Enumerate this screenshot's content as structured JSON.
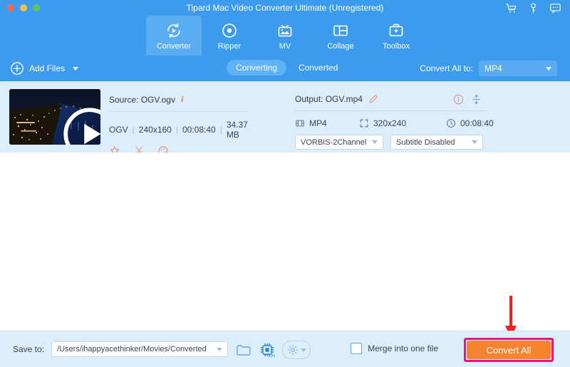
{
  "window": {
    "title": "Tipard Mac Video Converter Ultimate (Unregistered)",
    "traffic_lights": [
      "close-red",
      "minimize-yellow",
      "maximize-green"
    ],
    "right_icons": [
      {
        "name": "cart-icon",
        "label": "Cart"
      },
      {
        "name": "key-icon",
        "label": "Register"
      },
      {
        "name": "feedback-icon",
        "label": "Feedback"
      }
    ]
  },
  "tabs": [
    {
      "label": "Converter",
      "icon": "converter-icon",
      "active": true
    },
    {
      "label": "Ripper",
      "icon": "ripper-icon",
      "active": false
    },
    {
      "label": "MV",
      "icon": "mv-icon",
      "active": false
    },
    {
      "label": "Collage",
      "icon": "collage-icon",
      "active": false
    },
    {
      "label": "Toolbox",
      "icon": "toolbox-icon",
      "active": false
    }
  ],
  "actionbar": {
    "add_files_label": "Add Files",
    "segments": [
      {
        "label": "Converting",
        "active": true
      },
      {
        "label": "Converted",
        "active": false
      }
    ],
    "convert_all_to_label": "Convert All to:",
    "convert_all_to_value": "MP4"
  },
  "file_item": {
    "source_label": "Source: OGV.ogv",
    "meta": {
      "format": "OGV",
      "resolution": "240x160",
      "duration": "00:08:40",
      "size": "34.37 MB"
    },
    "tools": [
      {
        "name": "enhance-icon",
        "label": "Enhance"
      },
      {
        "name": "cut-icon",
        "label": "Cut"
      },
      {
        "name": "effect-icon",
        "label": "Effect"
      }
    ],
    "output_label": "Output: OGV.mp4",
    "output": {
      "format": "MP4",
      "resolution": "320x240",
      "duration": "00:08:40",
      "audio_track": "VORBIS-2Channel",
      "subtitle": "Subtitle Disabled"
    },
    "profile_badge": "MP4"
  },
  "bottombar": {
    "save_to_label": "Save to:",
    "save_to_path": "/Users/ihappyacethinker/Movies/Converted",
    "merge_label": "Merge into one file",
    "merge_checked": false,
    "convert_all_label": "Convert All",
    "icons": [
      {
        "name": "folder-icon",
        "label": "Open folder"
      },
      {
        "name": "gpu-acceleration-icon",
        "label": "GPU Acceleration ON"
      },
      {
        "name": "preferences-gear-icon",
        "label": "Preferences"
      }
    ]
  },
  "annotation": {
    "arrow": "red-down-arrow",
    "highlight_target": "convert-all-button"
  },
  "colors": {
    "header_blue": "#3d9bee",
    "tab_active_blue": "#5badf2",
    "row_blue": "#dcedfb",
    "bottom_blue": "#ddeefb",
    "orange": "#f5832f",
    "accent_orange": "#f1703c",
    "highlight_pink": "#e8147f",
    "annotation_red": "#ee2222"
  }
}
